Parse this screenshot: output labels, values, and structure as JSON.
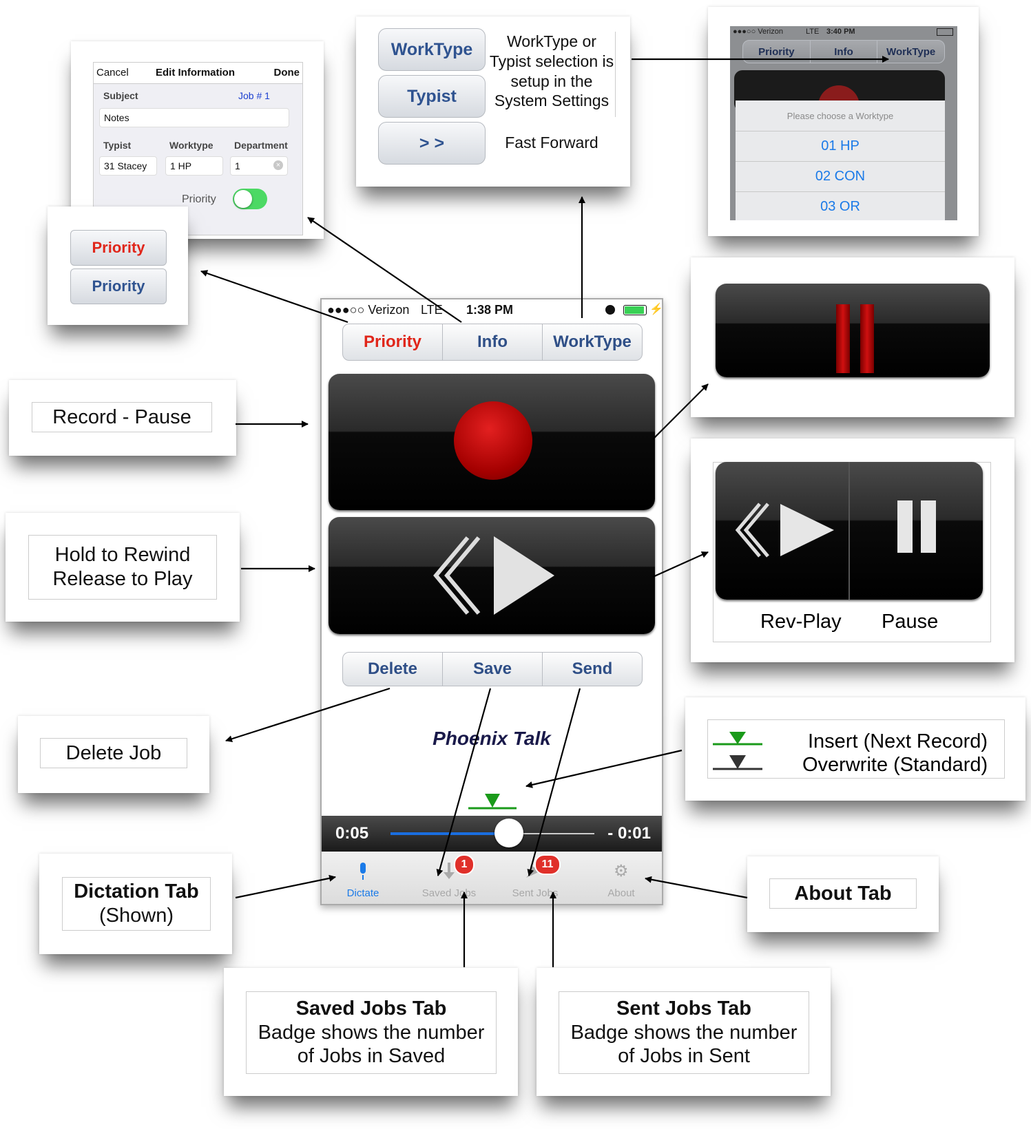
{
  "top_cards": {
    "edit_info": {
      "cancel": "Cancel",
      "title": "Edit Information",
      "done": "Done",
      "subject_label": "Subject",
      "job": "Job # 1",
      "notes": "Notes",
      "typist_label": "Typist",
      "worktype_label": "Worktype",
      "department_label": "Department",
      "typist_value": "31 Stacey",
      "worktype_value": "1 HP",
      "department_value": "1",
      "priority_label": "Priority"
    },
    "priority_buttons": {
      "red": "Priority",
      "blue": "Priority"
    },
    "worktype_card": {
      "worktype_btn": "WorkType",
      "typist_btn": "Typist",
      "ff_btn": "> >",
      "desc": "WorkType or Typist selection is setup in the System Settings",
      "ff_desc": "Fast Forward"
    },
    "picker_card": {
      "carrier": "●●●○○ Verizon",
      "network": "LTE",
      "time": "3:40 PM",
      "tab_priority": "Priority",
      "tab_info": "Info",
      "tab_worktype": "WorkType",
      "prompt": "Please choose a Worktype",
      "options": [
        "01 HP",
        "02 CON",
        "03 OR"
      ]
    }
  },
  "phone": {
    "carrier": "●●●○○ Verizon",
    "network": "LTE",
    "time": "1:38 PM",
    "seg_priority": "Priority",
    "seg_info": "Info",
    "seg_worktype": "WorkType",
    "delete": "Delete",
    "save": "Save",
    "send": "Send",
    "brand": "Phoenix Talk",
    "elapsed": "0:05",
    "remaining": "- 0:01",
    "progress": 0.58,
    "tabs": {
      "dictate": "Dictate",
      "saved": "Saved Jobs",
      "sent": "Sent Jobs",
      "about": "About"
    },
    "saved_badge": "1",
    "sent_badge": "11"
  },
  "labels": {
    "record_pause": "Record - Pause",
    "rewind_line1": "Hold to Rewind",
    "rewind_line2": "Release to Play",
    "delete_job": "Delete Job",
    "dictation_tab_title": "Dictation Tab",
    "dictation_tab_sub": "(Shown)",
    "about_tab": "About Tab",
    "saved_title": "Saved Jobs Tab",
    "saved_desc_1": "Badge shows the number",
    "saved_desc_2": "of Jobs in Saved",
    "sent_title": "Sent Jobs Tab",
    "sent_desc_1": "Badge shows the number",
    "sent_desc_2": "of Jobs in Sent",
    "insert": "Insert  (Next Record)",
    "overwrite": "Overwrite  (Standard)",
    "rev_play": "Rev-Play",
    "pause": "Pause"
  },
  "colors": {
    "accent_blue": "#2f5390",
    "priority_red": "#e0261a",
    "record_red": "#c00000",
    "toggle_green": "#4cd964",
    "insert_green": "#1a9a1a",
    "badge_red": "#e0302a"
  }
}
